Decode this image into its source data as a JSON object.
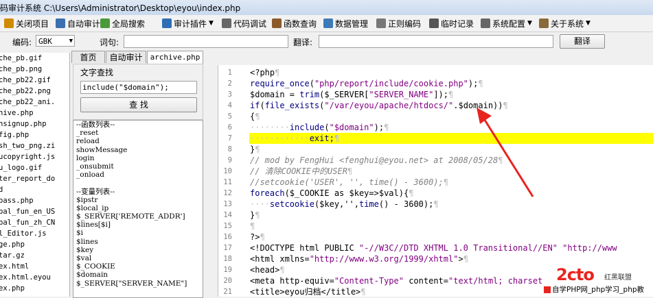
{
  "window": {
    "title": "码审计系统  C:\\Users\\Administrator\\Desktop\\eyou\\index.php"
  },
  "menu": [
    {
      "label": "关闭项目",
      "icon": "close-project-icon",
      "arrow": false
    },
    {
      "label": "自动审计",
      "icon": "auto-audit-icon",
      "arrow": false
    },
    {
      "label": "全局搜索",
      "icon": "global-search-icon",
      "arrow": false
    },
    {
      "label": "审计插件",
      "icon": "plugin-icon",
      "arrow": true
    },
    {
      "label": "代码调试",
      "icon": "debug-icon",
      "arrow": false
    },
    {
      "label": "函数查询",
      "icon": "function-query-icon",
      "arrow": false
    },
    {
      "label": "数据管理",
      "icon": "data-manage-icon",
      "arrow": false
    },
    {
      "label": "正则编码",
      "icon": "regex-icon",
      "arrow": false
    },
    {
      "label": "临时记录",
      "icon": "notes-icon",
      "arrow": false
    },
    {
      "label": "系统配置",
      "icon": "gear-icon",
      "arrow": true
    },
    {
      "label": "关于系统",
      "icon": "about-icon",
      "arrow": true
    }
  ],
  "toolbar": {
    "encoding_label": "编码:",
    "encoding_value": "GBK",
    "word_label": "词句:",
    "word_value": "",
    "translate_label": "翻译:",
    "translate_value": "",
    "translate_button": "翻译"
  },
  "files": [
    "che_pb.gif",
    "che_pb.png",
    "che_pb22.gif",
    "che_pb22.png",
    "che_pb22_ani.",
    "hive.php",
    "hsignup.php",
    "fig.php",
    "sh_two_png.zi",
    "ucopyright.js",
    "u_logo.gif",
    "ter_report_do",
    "d",
    "pass.php",
    "bal_fun_en_US",
    "bal_fun_zh_CN",
    "l_Editor.js",
    "ge.php",
    "tar.gz",
    "ex.html",
    "ex.html.eyou",
    "ex.php"
  ],
  "tabs": [
    "首页",
    "自动审计",
    "archive.php"
  ],
  "search": {
    "title": "文字查找",
    "value": "include(\"$domain\");",
    "button": "查 找"
  },
  "functions": [
    "--函数列表--",
    "_reset",
    "reload",
    "showMessage",
    "login",
    "_onsubmit",
    "_onload",
    "",
    "--变量列表--",
    "$ipstr",
    "$local_ip",
    "$_SERVER['REMOTE_ADDR']",
    "$lines[$i]",
    "$i",
    "$lines",
    "$key",
    "$val",
    "$_COOKIE",
    "$domain",
    "$_SERVER[\"SERVER_NAME\"]"
  ],
  "code_lines": [
    [
      {
        "t": "<?php",
        "c": ""
      },
      {
        "t": "¶",
        "c": "pm"
      }
    ],
    [
      {
        "t": "require_once",
        "c": "kw"
      },
      {
        "t": "(",
        "c": ""
      },
      {
        "t": "\"php/report/include/cookie.php\"",
        "c": "str"
      },
      {
        "t": ");",
        "c": ""
      },
      {
        "t": "¶",
        "c": "pm"
      }
    ],
    [
      {
        "t": "$domain = ",
        "c": ""
      },
      {
        "t": "trim",
        "c": "kw"
      },
      {
        "t": "($_SERVER[",
        "c": ""
      },
      {
        "t": "\"SERVER_NAME\"",
        "c": "str"
      },
      {
        "t": "]);",
        "c": ""
      },
      {
        "t": "¶",
        "c": "pm"
      }
    ],
    [
      {
        "t": "if",
        "c": "kw"
      },
      {
        "t": "(",
        "c": ""
      },
      {
        "t": "file_exists",
        "c": "kw"
      },
      {
        "t": "(",
        "c": ""
      },
      {
        "t": "\"/var/eyou/apache/htdocs/\"",
        "c": "str"
      },
      {
        "t": ".$domain))",
        "c": ""
      },
      {
        "t": "¶",
        "c": "pm"
      }
    ],
    [
      {
        "t": "{",
        "c": ""
      },
      {
        "t": "¶",
        "c": "pm"
      }
    ],
    [
      {
        "t": "········",
        "c": "pm"
      },
      {
        "t": "include",
        "c": "kw"
      },
      {
        "t": "(",
        "c": ""
      },
      {
        "t": "\"$domain\"",
        "c": "str"
      },
      {
        "t": ");",
        "c": ""
      },
      {
        "t": "¶",
        "c": "pm"
      }
    ],
    [
      {
        "t": "············",
        "c": "pm"
      },
      {
        "t": "exit;",
        "c": "kw"
      },
      {
        "t": "¶",
        "c": "pm"
      }
    ],
    [
      {
        "t": "}",
        "c": ""
      },
      {
        "t": "¶",
        "c": "pm"
      }
    ],
    [
      {
        "t": "// mod by FengHui <fenghui@eyou.net> at 2008/05/28",
        "c": "cm"
      },
      {
        "t": "¶",
        "c": "pm"
      }
    ],
    [
      {
        "t": "// 清除COOKIE中的USER",
        "c": "cm"
      },
      {
        "t": "¶",
        "c": "pm"
      }
    ],
    [
      {
        "t": "//setcookie('USER', '', time() - 3600);",
        "c": "cm"
      },
      {
        "t": "¶",
        "c": "pm"
      }
    ],
    [
      {
        "t": "foreach",
        "c": "kw"
      },
      {
        "t": "($_COOKIE as $key=>$val){",
        "c": ""
      },
      {
        "t": "¶",
        "c": "pm"
      }
    ],
    [
      {
        "t": "····",
        "c": "pm"
      },
      {
        "t": "setcookie",
        "c": "kw"
      },
      {
        "t": "($key,'',",
        "c": ""
      },
      {
        "t": "time",
        "c": "kw"
      },
      {
        "t": "() - 3600);",
        "c": ""
      },
      {
        "t": "¶",
        "c": "pm"
      }
    ],
    [
      {
        "t": "}",
        "c": ""
      },
      {
        "t": "¶",
        "c": "pm"
      }
    ],
    [
      {
        "t": "¶",
        "c": "pm"
      }
    ],
    [
      {
        "t": "?>",
        "c": ""
      },
      {
        "t": "¶",
        "c": "pm"
      }
    ],
    [
      {
        "t": "<!DOCTYPE html PUBLIC ",
        "c": ""
      },
      {
        "t": "\"-//W3C//DTD XHTML 1.0 Transitional//EN\"",
        "c": "str"
      },
      {
        "t": " ",
        "c": ""
      },
      {
        "t": "\"http://www",
        "c": "str"
      }
    ],
    [
      {
        "t": "<html xmlns=",
        "c": ""
      },
      {
        "t": "\"http://www.w3.org/1999/xhtml\"",
        "c": "str"
      },
      {
        "t": ">",
        "c": ""
      },
      {
        "t": "¶",
        "c": "pm"
      }
    ],
    [
      {
        "t": "<head>",
        "c": ""
      },
      {
        "t": "¶",
        "c": "pm"
      }
    ],
    [
      {
        "t": "<meta http-equiv=",
        "c": ""
      },
      {
        "t": "\"Content-Type\"",
        "c": "str"
      },
      {
        "t": " content=",
        "c": ""
      },
      {
        "t": "\"text/html; charset",
        "c": "str"
      }
    ],
    [
      {
        "t": "<title>eyou归档</title>",
        "c": ""
      },
      {
        "t": "¶",
        "c": "pm"
      }
    ]
  ],
  "highlight_line": 7,
  "watermark": {
    "top": "红黑联盟",
    "bottom": "自学PHP网_php学习_php教"
  },
  "colors": {
    "keyword": "#000080",
    "string": "#800080",
    "comment": "#808080",
    "highlight": "#ffff00",
    "arrow": "#e8241f"
  }
}
